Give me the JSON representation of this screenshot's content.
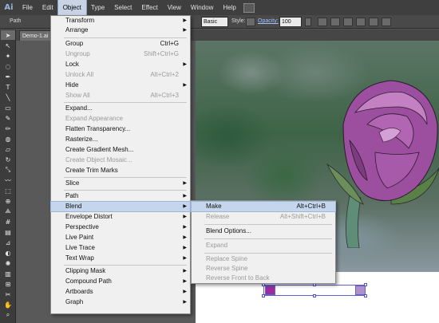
{
  "menubar": {
    "logo": "Ai",
    "items": [
      "File",
      "Edit",
      "Object",
      "Type",
      "Select",
      "Effect",
      "View",
      "Window",
      "Help"
    ],
    "active_index": 2
  },
  "control_bar": {
    "path_label": "Path",
    "brush_value": "Basic",
    "style_label": "Style:",
    "opacity_label": "Opacity:",
    "opacity_value": "100"
  },
  "document": {
    "tab_label": "Demo-1.ai"
  },
  "object_menu": {
    "items": [
      {
        "label": "Transform",
        "submenu": true,
        "disabled": false
      },
      {
        "label": "Arrange",
        "submenu": true,
        "disabled": false
      },
      {
        "label": "Group",
        "shortcut": "Ctrl+G",
        "disabled": false
      },
      {
        "label": "Ungroup",
        "shortcut": "Shift+Ctrl+G",
        "disabled": true
      },
      {
        "label": "Lock",
        "submenu": true,
        "disabled": false
      },
      {
        "label": "Unlock All",
        "shortcut": "Alt+Ctrl+2",
        "disabled": true
      },
      {
        "label": "Hide",
        "submenu": true,
        "disabled": false
      },
      {
        "label": "Show All",
        "shortcut": "Alt+Ctrl+3",
        "disabled": true
      },
      {
        "label": "Expand...",
        "disabled": false
      },
      {
        "label": "Expand Appearance",
        "disabled": true
      },
      {
        "label": "Flatten Transparency...",
        "disabled": false
      },
      {
        "label": "Rasterize...",
        "disabled": false
      },
      {
        "label": "Create Gradient Mesh...",
        "disabled": false
      },
      {
        "label": "Create Object Mosaic...",
        "disabled": true
      },
      {
        "label": "Create Trim Marks",
        "disabled": false
      },
      {
        "label": "Slice",
        "submenu": true,
        "disabled": false
      },
      {
        "label": "Path",
        "submenu": true,
        "disabled": false
      },
      {
        "label": "Blend",
        "submenu": true,
        "disabled": false,
        "highlighted": true
      },
      {
        "label": "Envelope Distort",
        "submenu": true,
        "disabled": false
      },
      {
        "label": "Perspective",
        "submenu": true,
        "disabled": false
      },
      {
        "label": "Live Paint",
        "submenu": true,
        "disabled": false
      },
      {
        "label": "Live Trace",
        "submenu": true,
        "disabled": false
      },
      {
        "label": "Text Wrap",
        "submenu": true,
        "disabled": false
      },
      {
        "label": "Clipping Mask",
        "submenu": true,
        "disabled": false
      },
      {
        "label": "Compound Path",
        "submenu": true,
        "disabled": false
      },
      {
        "label": "Artboards",
        "submenu": true,
        "disabled": false
      },
      {
        "label": "Graph",
        "submenu": true,
        "disabled": false
      }
    ]
  },
  "blend_menu": {
    "items": [
      {
        "label": "Make",
        "shortcut": "Alt+Ctrl+B",
        "disabled": false,
        "highlighted": true
      },
      {
        "label": "Release",
        "shortcut": "Alt+Shift+Ctrl+B",
        "disabled": true
      },
      {
        "label": "Blend Options...",
        "disabled": false
      },
      {
        "label": "Expand",
        "disabled": true
      },
      {
        "label": "Replace Spine",
        "disabled": true
      },
      {
        "label": "Reverse Spine",
        "disabled": true
      },
      {
        "label": "Reverse Front to Back",
        "disabled": true
      }
    ]
  }
}
